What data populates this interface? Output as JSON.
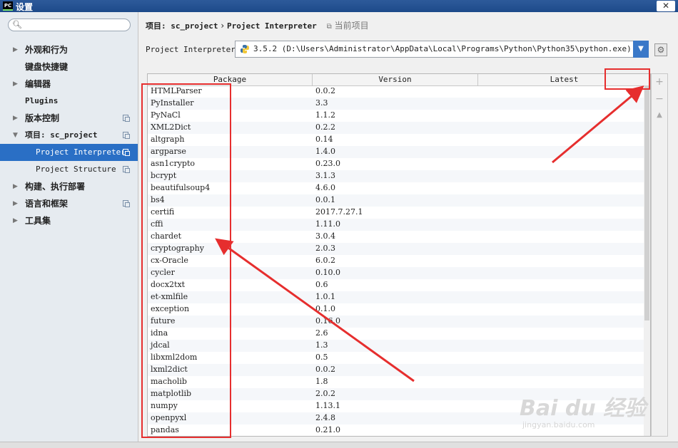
{
  "window": {
    "app_icon": "PC",
    "title": "设置",
    "close": "✕"
  },
  "sidebar": {
    "search_placeholder": "",
    "items": [
      {
        "label": "外观和行为",
        "arrow": "▶"
      },
      {
        "label": "键盘快捷键"
      },
      {
        "label": "编辑器",
        "arrow": "▶"
      },
      {
        "label": "Plugins"
      },
      {
        "label": "版本控制",
        "arrow": "▶"
      },
      {
        "label": "项目: sc_project",
        "arrow": "▼"
      },
      {
        "label": "Project Interpreter"
      },
      {
        "label": "Project Structure"
      },
      {
        "label": "构建、执行部署",
        "arrow": "▶"
      },
      {
        "label": "语言和框架",
        "arrow": "▶"
      },
      {
        "label": "工具集",
        "arrow": "▶"
      }
    ]
  },
  "breadcrumb": {
    "root": "项目: sc_project",
    "sep": "›",
    "page": "Project Interpreter",
    "note": "当前项目"
  },
  "interpreter": {
    "label": "Project Interpreter:",
    "value": "3.5.2 (D:\\Users\\Administrator\\AppData\\Local\\Programs\\Python\\Python35\\python.exe)"
  },
  "table": {
    "columns": [
      "Package",
      "Version",
      "Latest"
    ],
    "rows": [
      [
        "HTMLParser",
        "0.0.2"
      ],
      [
        "PyInstaller",
        "3.3"
      ],
      [
        "PyNaCl",
        "1.1.2"
      ],
      [
        "XML2Dict",
        "0.2.2"
      ],
      [
        "altgraph",
        "0.14"
      ],
      [
        "argparse",
        "1.4.0"
      ],
      [
        "asn1crypto",
        "0.23.0"
      ],
      [
        "bcrypt",
        "3.1.3"
      ],
      [
        "beautifulsoup4",
        "4.6.0"
      ],
      [
        "bs4",
        "0.0.1"
      ],
      [
        "certifi",
        "2017.7.27.1"
      ],
      [
        "cffi",
        "1.11.0"
      ],
      [
        "chardet",
        "3.0.4"
      ],
      [
        "cryptography",
        "2.0.3"
      ],
      [
        "cx-Oracle",
        "6.0.2"
      ],
      [
        "cycler",
        "0.10.0"
      ],
      [
        "docx2txt",
        "0.6"
      ],
      [
        "et-xmlfile",
        "1.0.1"
      ],
      [
        "exception",
        "0.1.0"
      ],
      [
        "future",
        "0.16.0"
      ],
      [
        "idna",
        "2.6"
      ],
      [
        "jdcal",
        "1.3"
      ],
      [
        "libxml2dom",
        "0.5"
      ],
      [
        "lxml2dict",
        "0.0.2"
      ],
      [
        "macholib",
        "1.8"
      ],
      [
        "matplotlib",
        "2.0.2"
      ],
      [
        "numpy",
        "1.13.1"
      ],
      [
        "openpyxl",
        "2.4.8"
      ],
      [
        "pandas",
        "0.21.0"
      ]
    ]
  },
  "tools": {
    "add": "+",
    "remove": "−",
    "upgrade": "▲"
  },
  "watermark": {
    "brand": "Bai du 经验",
    "url": "jingyan.baidu.com"
  },
  "colors": {
    "accent": "#2a6fc5",
    "annotation": "#e62e2e"
  }
}
